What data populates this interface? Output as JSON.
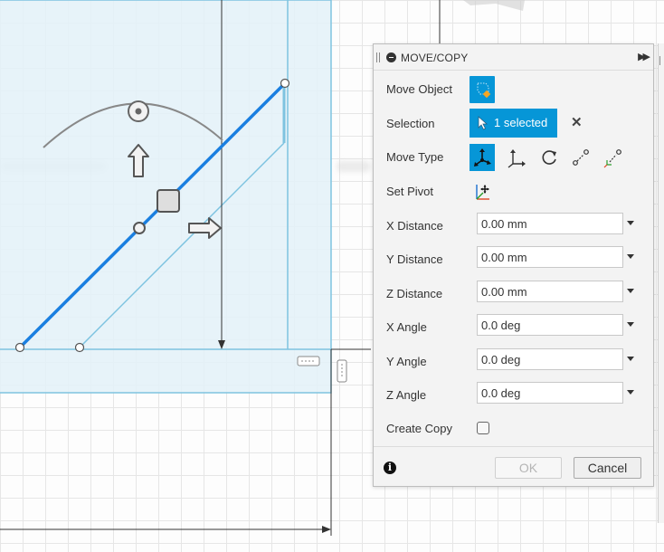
{
  "dialog": {
    "title": "MOVE/COPY",
    "expand_icon": "double-chevron-right-icon",
    "rows": {
      "move_object": {
        "label": "Move Object",
        "icon": "body-select-icon"
      },
      "selection": {
        "label": "Selection",
        "button": "1 selected",
        "clear_icon": "close-icon"
      },
      "move_type": {
        "label": "Move Type",
        "options": [
          "free-move-icon",
          "translate-icon",
          "rotate-icon",
          "point-to-point-icon",
          "point-to-position-icon"
        ],
        "active": "free-move-icon"
      },
      "set_pivot": {
        "label": "Set Pivot",
        "icon": "pivot-axes-icon"
      },
      "x_distance": {
        "label": "X Distance",
        "value": "0.00 mm"
      },
      "y_distance": {
        "label": "Y Distance",
        "value": "0.00 mm"
      },
      "z_distance": {
        "label": "Z Distance",
        "value": "0.00 mm"
      },
      "x_angle": {
        "label": "X Angle",
        "value": "0.0 deg"
      },
      "y_angle": {
        "label": "Y Angle",
        "value": "0.0 deg"
      },
      "z_angle": {
        "label": "Z Angle",
        "value": "0.0 deg"
      },
      "create_copy": {
        "label": "Create Copy",
        "checked": false
      }
    },
    "footer": {
      "info_icon": "info-icon",
      "ok": "OK",
      "cancel": "Cancel",
      "ok_enabled": false
    }
  },
  "colors": {
    "accent": "#0696d7",
    "sketch_line": "#1a7fe0",
    "sketch_fill": "#e3f1f8",
    "sketch_edge": "#7ec3e0"
  }
}
